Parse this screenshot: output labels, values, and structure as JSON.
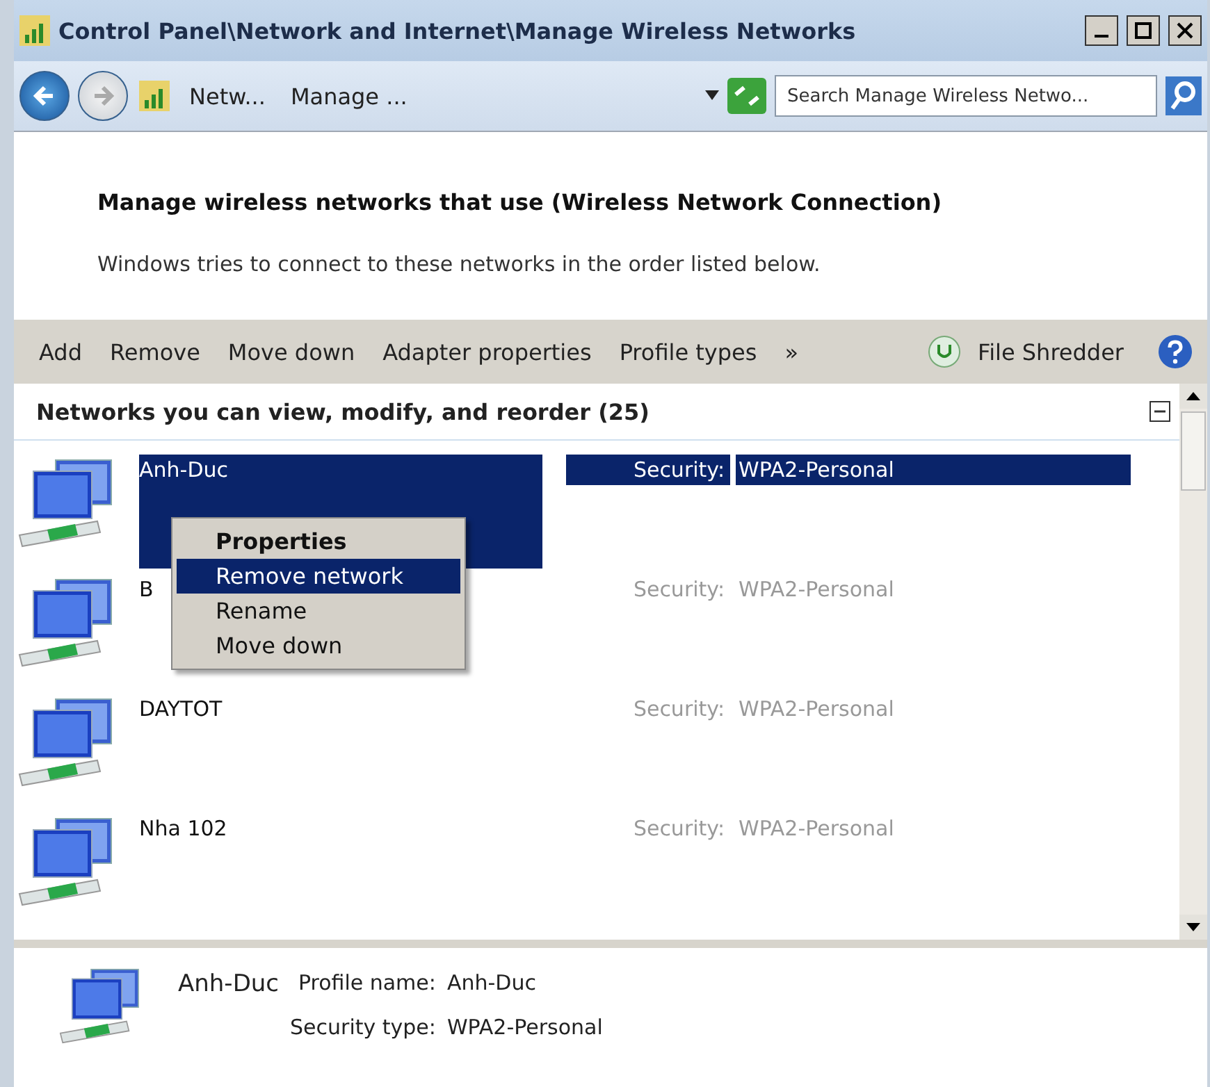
{
  "window": {
    "title": "Control Panel\\Network and Internet\\Manage Wireless Networks"
  },
  "address_bar": {
    "breadcrumbs": [
      "Netw...",
      "Manage ..."
    ],
    "search": {
      "placeholder": "Search Manage Wireless Netwo..."
    }
  },
  "header": {
    "title": "Manage wireless networks that use (Wireless Network Connection)",
    "subtitle": "Windows tries to connect to these networks in the order listed below."
  },
  "toolbar": {
    "items": [
      "Add",
      "Remove",
      "Move down",
      "Adapter properties",
      "Profile types"
    ],
    "overflow": "»",
    "extra": "File Shredder"
  },
  "list": {
    "heading": "Networks you can view, modify, and reorder (25)"
  },
  "networks": [
    {
      "name": "Anh-Duc",
      "security_label": "Security:",
      "security": "WPA2-Personal",
      "selected": true
    },
    {
      "name": "B",
      "security_label": "Security:",
      "security": "WPA2-Personal",
      "selected": false
    },
    {
      "name": "DAYTOT",
      "security_label": "Security:",
      "security": "WPA2-Personal",
      "selected": false
    },
    {
      "name": "Nha 102",
      "security_label": "Security:",
      "security": "WPA2-Personal",
      "selected": false
    }
  ],
  "context_menu": {
    "items": [
      {
        "label": "Properties",
        "default": true,
        "selected": false
      },
      {
        "label": "Remove network",
        "default": false,
        "selected": true
      },
      {
        "label": "Rename",
        "default": false,
        "selected": false
      },
      {
        "label": "Move down",
        "default": false,
        "selected": false
      }
    ]
  },
  "details": {
    "name": "Anh-Duc",
    "fields": [
      {
        "label": "Profile name:",
        "value": "Anh-Duc"
      },
      {
        "label": "Security type:",
        "value": "WPA2-Personal"
      }
    ]
  }
}
